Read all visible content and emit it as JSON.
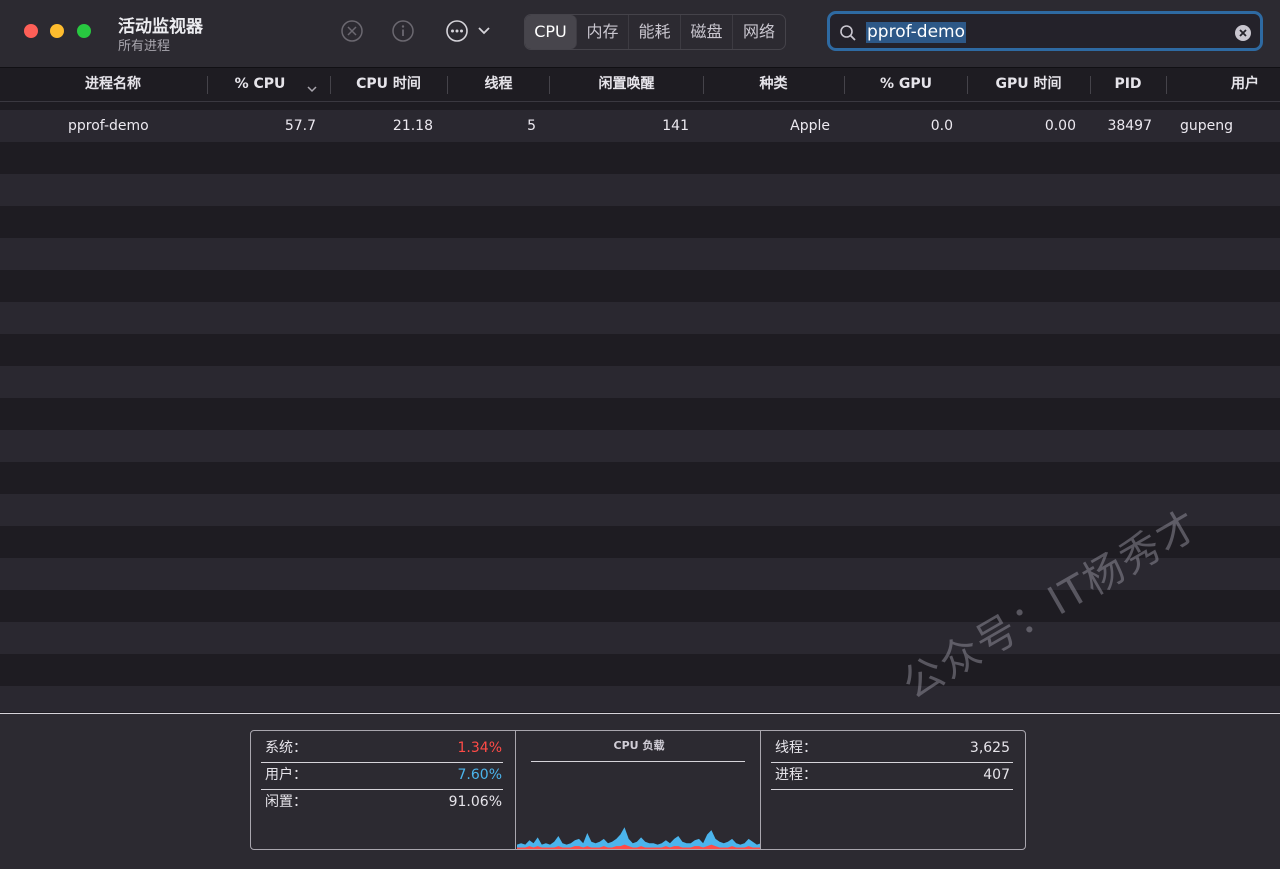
{
  "window": {
    "title": "活动监视器",
    "subtitle": "所有进程"
  },
  "toolbar": {
    "icons": [
      "stop-icon",
      "info-icon",
      "more-icon",
      "chevron-down-icon"
    ],
    "tabs": [
      {
        "label": "CPU",
        "active": true
      },
      {
        "label": "内存",
        "active": false
      },
      {
        "label": "能耗",
        "active": false
      },
      {
        "label": "磁盘",
        "active": false
      },
      {
        "label": "网络",
        "active": false
      }
    ]
  },
  "search": {
    "value": "pprof-demo"
  },
  "table": {
    "columns": [
      "进程名称",
      "% CPU",
      "CPU 时间",
      "线程",
      "闲置唤醒",
      "种类",
      "% GPU",
      "GPU 时间",
      "PID",
      "用户"
    ],
    "sorted_column": "% CPU",
    "rows": [
      {
        "name": "pprof-demo",
        "cpu": "57.7",
        "cpu_time": "21.18",
        "threads": "5",
        "idle_wakeups": "141",
        "kind": "Apple",
        "gpu": "0.0",
        "gpu_time": "0.00",
        "pid": "38497",
        "user": "gupeng"
      }
    ]
  },
  "stats": {
    "system": {
      "label": "系统：",
      "value": "1.34%",
      "color": "#ff4b47"
    },
    "user": {
      "label": "用户：",
      "value": "7.60%",
      "color": "#4bb4ec"
    },
    "idle": {
      "label": "闲置：",
      "value": "91.06%"
    },
    "chart_title": "CPU 负载",
    "threads": {
      "label": "线程：",
      "value": "3,625"
    },
    "processes": {
      "label": "进程：",
      "value": "407"
    }
  },
  "cpu_load": {
    "user": [
      2,
      3,
      2,
      4,
      3,
      6,
      2,
      3,
      2,
      4,
      7,
      3,
      2,
      3,
      4,
      5,
      3,
      9,
      4,
      3,
      4,
      5,
      3,
      4,
      5,
      8,
      12,
      5,
      3,
      4,
      6,
      4,
      3,
      3,
      2,
      3,
      4,
      3,
      5,
      7,
      4,
      3,
      3,
      4,
      5,
      3,
      8,
      10,
      5,
      4,
      3,
      4,
      5,
      3,
      2,
      3,
      5,
      4,
      2,
      3
    ],
    "system": [
      1,
      1,
      1,
      2,
      1,
      2,
      1,
      1,
      1,
      1,
      2,
      1,
      1,
      1,
      2,
      2,
      1,
      2,
      1,
      1,
      1,
      2,
      1,
      1,
      2,
      2,
      3,
      2,
      1,
      1,
      2,
      1,
      1,
      1,
      1,
      1,
      2,
      1,
      2,
      2,
      1,
      1,
      1,
      2,
      2,
      1,
      2,
      3,
      2,
      1,
      1,
      1,
      2,
      1,
      1,
      1,
      2,
      1,
      1,
      1
    ]
  },
  "watermark": "公众号：IT杨秀才"
}
